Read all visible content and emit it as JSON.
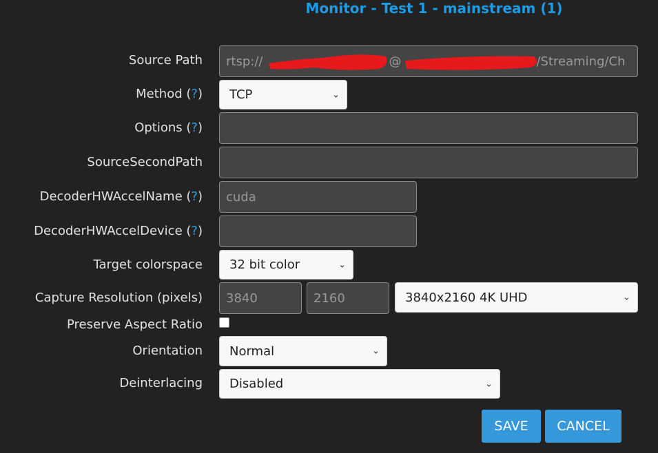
{
  "title": "Monitor - Test 1 - mainstream (1)",
  "help_mark": "?",
  "fields": {
    "source_path": {
      "label": "Source Path",
      "value_prefix": "rtsp://",
      "value_at": "@",
      "value_suffix": "/Streaming/Ch"
    },
    "method": {
      "label": "Method",
      "value": "TCP"
    },
    "options": {
      "label": "Options",
      "value": ""
    },
    "source_second_path": {
      "label": "SourceSecondPath",
      "value": ""
    },
    "decoder_hw_accel_name": {
      "label": "DecoderHWAccelName",
      "value": "cuda"
    },
    "decoder_hw_accel_device": {
      "label": "DecoderHWAccelDevice ",
      "value": ""
    },
    "target_colorspace": {
      "label": "Target colorspace",
      "value": "32 bit color"
    },
    "capture_resolution": {
      "label": "Capture Resolution (pixels)",
      "width": "3840",
      "height": "2160",
      "preset": "3840x2160 4K UHD"
    },
    "preserve_aspect_ratio": {
      "label": "Preserve Aspect Ratio",
      "checked": false
    },
    "orientation": {
      "label": "Orientation",
      "value": "Normal"
    },
    "deinterlacing": {
      "label": "Deinterlacing",
      "value": "Disabled"
    }
  },
  "buttons": {
    "save": "SAVE",
    "cancel": "CANCEL"
  },
  "icons": {
    "dropdown": "chevron-down-icon"
  },
  "colors": {
    "accent": "#3498db",
    "title": "#1e9be3",
    "background": "#222222",
    "redaction": "#e8191c"
  }
}
